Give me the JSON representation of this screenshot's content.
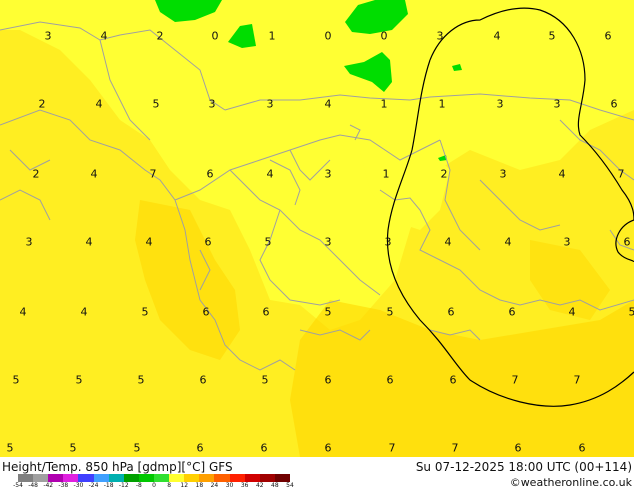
{
  "map": {
    "field_values": [
      [
        "3",
        "4",
        "2",
        "0",
        "1",
        "0",
        "0",
        "3",
        "4",
        "5",
        "6"
      ],
      [
        "2",
        "4",
        "5",
        "3",
        "3",
        "4",
        "1",
        "1",
        "3",
        "3",
        "6"
      ],
      [
        "2",
        "4",
        "7",
        "6",
        "4",
        "3",
        "1",
        "2",
        "3",
        "4",
        "7"
      ],
      [
        "3",
        "4",
        "4",
        "6",
        "5",
        "3",
        "3",
        "4",
        "4",
        "3",
        "6"
      ],
      [
        "4",
        "4",
        "5",
        "6",
        "6",
        "5",
        "5",
        "6",
        "6",
        "4",
        "5"
      ],
      [
        "5",
        "5",
        "5",
        "6",
        "5",
        "6",
        "6",
        "6",
        "7",
        "7"
      ],
      [
        "5",
        "5",
        "5",
        "6",
        "6",
        "6",
        "7",
        "7",
        "6",
        "6"
      ]
    ],
    "colors": {
      "light_yellow": "#ffff33",
      "yellow": "#ffee22",
      "gold": "#ffd700",
      "green": "#00dd00",
      "border": "#a0a0a0",
      "contour": "#000000"
    }
  },
  "footer": {
    "title": "Height/Temp. 850 hPa [gdmp][°C] GFS",
    "datetime": "Su 07-12-2025 18:00 UTC (00+114)",
    "credit": "©weatheronline.co.uk",
    "colorbar_ticks": [
      "-54",
      "-48",
      "-42",
      "-38",
      "-30",
      "-24",
      "-18",
      "-12",
      "-8",
      "0",
      "8",
      "12",
      "18",
      "24",
      "30",
      "36",
      "42",
      "48",
      "54"
    ],
    "colorbar_colors": [
      "#808080",
      "#a0a0a0",
      "#b000b0",
      "#e020e0",
      "#4040ff",
      "#40a0ff",
      "#00b0b0",
      "#00a000",
      "#00c800",
      "#30e030",
      "#ffff30",
      "#ffd000",
      "#ffa000",
      "#ff6000",
      "#ff2000",
      "#d00000",
      "#a00000",
      "#700000"
    ]
  }
}
